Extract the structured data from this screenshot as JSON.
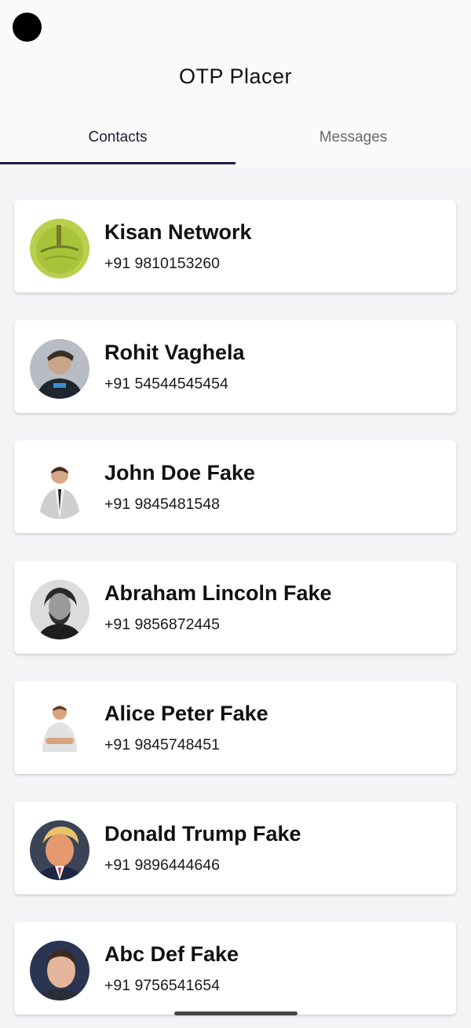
{
  "app": {
    "title": "OTP Placer"
  },
  "tabs": [
    {
      "label": "Contacts",
      "active": true
    },
    {
      "label": "Messages",
      "active": false
    }
  ],
  "colors": {
    "accent": "#1c1f4a",
    "background": "#f4f4f6",
    "card": "#ffffff"
  },
  "contacts": [
    {
      "name": "Kisan Network",
      "phone": "+91 9810153260",
      "avatar_icon": "kisan-network-logo-icon"
    },
    {
      "name": "Rohit Vaghela",
      "phone": "+91 54544545454",
      "avatar_icon": "person-photo-icon"
    },
    {
      "name": "John Doe Fake",
      "phone": "+91 9845481548",
      "avatar_icon": "person-suit-photo-icon"
    },
    {
      "name": "Abraham Lincoln Fake",
      "phone": "+91 9856872445",
      "avatar_icon": "portrait-photo-icon"
    },
    {
      "name": "Alice Peter Fake",
      "phone": "+91 9845748451",
      "avatar_icon": "person-photo-icon"
    },
    {
      "name": "Donald Trump Fake",
      "phone": "+91 9896444646",
      "avatar_icon": "person-photo-icon"
    },
    {
      "name": "Abc Def Fake",
      "phone": "+91 9756541654",
      "avatar_icon": "person-photo-icon"
    }
  ]
}
